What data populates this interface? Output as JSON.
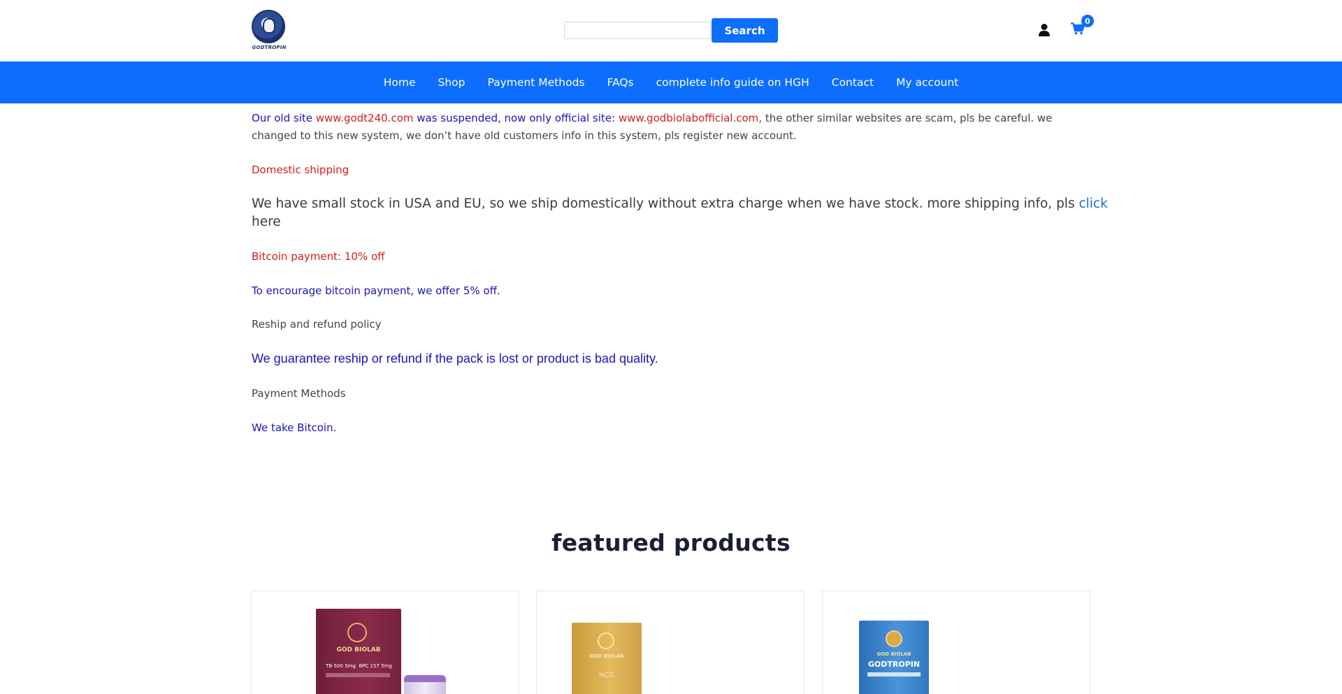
{
  "header": {
    "logo_text": "GODTROPIN",
    "search": {
      "placeholder": "",
      "value": "",
      "button_label": "Search"
    },
    "cart_count": "0",
    "icons": {
      "user": "user-icon",
      "cart": "cart-icon"
    }
  },
  "nav": {
    "items": [
      {
        "label": "Home"
      },
      {
        "label": "Shop"
      },
      {
        "label": "Payment Methods"
      },
      {
        "label": "FAQs"
      },
      {
        "label": "complete info guide on HGH"
      },
      {
        "label": "Contact"
      },
      {
        "label": "My account"
      }
    ]
  },
  "notice": {
    "part1": "Our old site ",
    "old_site": "www.godt240.com",
    "part2": " was suspended, now only official site: ",
    "official_site": "www.godbiolabofficial.com",
    "part3": ", the other similar websites are scam, pls be careful. we",
    "line2": "changed to this new system, we don’t have old customers info in this system, pls register new account."
  },
  "domestic": {
    "heading": "Domestic shipping",
    "text": "We have small stock in USA and EU, so we ship domestically without extra charge when we have stock. more shipping info, pls ",
    "link_part1": "click",
    "link_part2": "here"
  },
  "bitcoin": {
    "heading": "Bitcoin payment: 10% off",
    "text": "To encourage bitcoin payment, we offer 5% off."
  },
  "reship": {
    "heading": "Reship and refund policy",
    "text": "We guarantee reship or refund if the pack is lost or product is bad quality."
  },
  "payment": {
    "heading": "Payment Methods",
    "text": "We take Bitcoin."
  },
  "featured": {
    "title": "featured products",
    "products": [
      {
        "brand": "GOD BIOLAB",
        "label1": "TB-500",
        "dose1": "5mg",
        "label2": "BPC 157",
        "dose2": "5mg"
      },
      {
        "brand": "GOD BIOLAB",
        "label1": "HCG"
      },
      {
        "brand": "GOD BIOLAB",
        "label1": "GODTROPIN"
      }
    ]
  },
  "colors": {
    "primary": "#0d6efd",
    "notice_blue": "#1c14b4",
    "notice_red": "#d01f1f",
    "link_blue": "#1a6fd6",
    "heading_dark": "#1a1f36"
  }
}
